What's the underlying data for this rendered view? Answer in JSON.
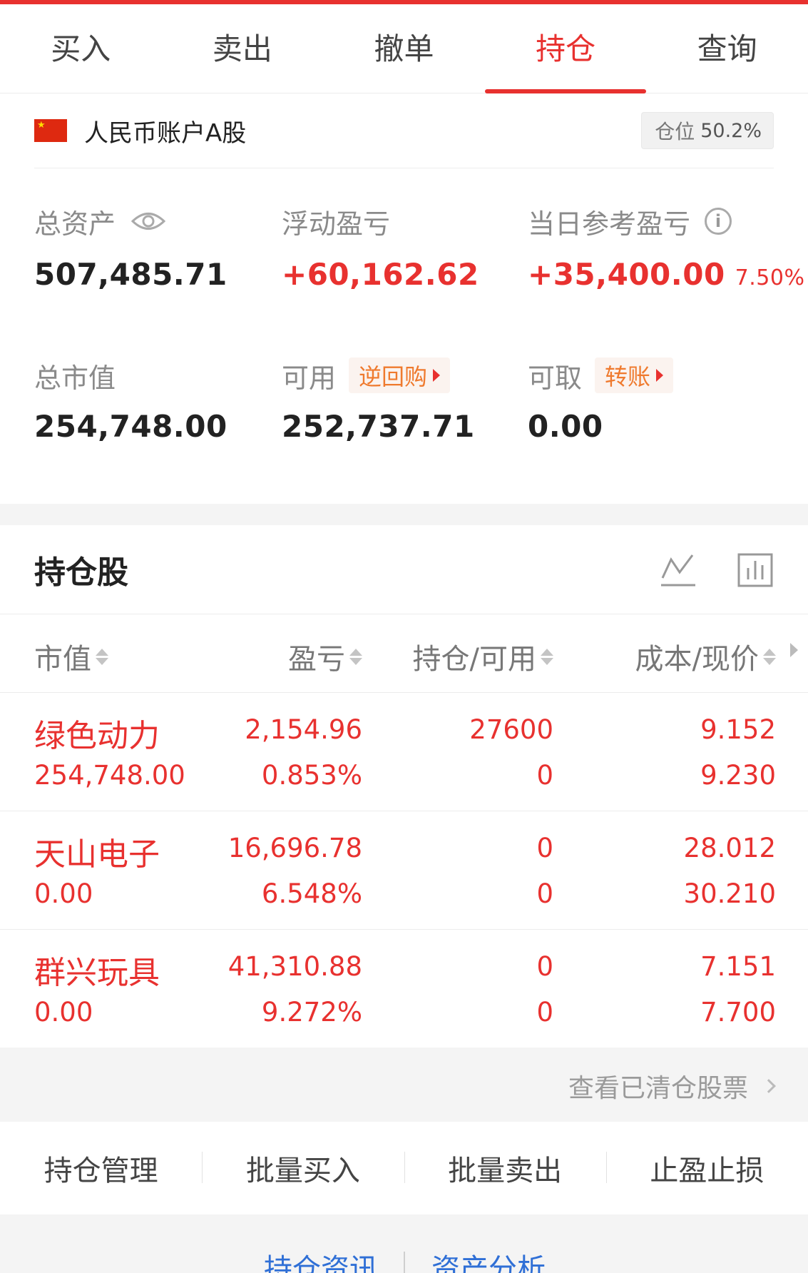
{
  "tabs": [
    {
      "label": "买入"
    },
    {
      "label": "卖出"
    },
    {
      "label": "撤单"
    },
    {
      "label": "持仓"
    },
    {
      "label": "查询"
    }
  ],
  "active_tab": "持仓",
  "account": {
    "name": "人民币账户A股",
    "position_label": "仓位",
    "position_value": "50.2%"
  },
  "summary": {
    "total_assets_label": "总资产",
    "total_assets": "507,485.71",
    "floating_pl_label": "浮动盈亏",
    "floating_pl": "+60,162.62",
    "daily_pl_label": "当日参考盈亏",
    "daily_pl": "+35,400.00",
    "daily_pl_pct": "7.50%",
    "market_value_label": "总市值",
    "market_value": "254,748.00",
    "available_label": "可用",
    "available": "252,737.71",
    "reverse_repo_label": "逆回购",
    "withdrawable_label": "可取",
    "withdrawable": "0.00",
    "transfer_label": "转账"
  },
  "holdings": {
    "title": "持仓股",
    "columns": [
      "市值",
      "盈亏",
      "持仓/可用",
      "成本/现价"
    ],
    "rows": [
      {
        "name": "绿色动力",
        "market_value": "254,748.00",
        "pl": "2,154.96",
        "pl_pct": "0.853%",
        "position": "27600",
        "available": "0",
        "cost": "9.152",
        "price": "9.230"
      },
      {
        "name": "天山电子",
        "market_value": "0.00",
        "pl": "16,696.78",
        "pl_pct": "6.548%",
        "position": "0",
        "available": "0",
        "cost": "28.012",
        "price": "30.210"
      },
      {
        "name": "群兴玩具",
        "market_value": "0.00",
        "pl": "41,310.88",
        "pl_pct": "9.272%",
        "position": "0",
        "available": "0",
        "cost": "7.151",
        "price": "7.700"
      }
    ],
    "cleared_link": "查看已清仓股票"
  },
  "actions": [
    {
      "label": "持仓管理"
    },
    {
      "label": "批量买入"
    },
    {
      "label": "批量卖出"
    },
    {
      "label": "止盈止损"
    }
  ],
  "bottom_links": [
    {
      "label": "持仓资讯"
    },
    {
      "label": "资产分析"
    }
  ],
  "colors": {
    "accent_red": "#e8312f",
    "link_orange": "#ef7a2e",
    "link_blue": "#2f6fd6"
  },
  "icons": [
    "eye-icon",
    "info-icon",
    "line-chart-icon",
    "bar-chart-icon",
    "china-flag-icon",
    "chevron-right-icon"
  ]
}
